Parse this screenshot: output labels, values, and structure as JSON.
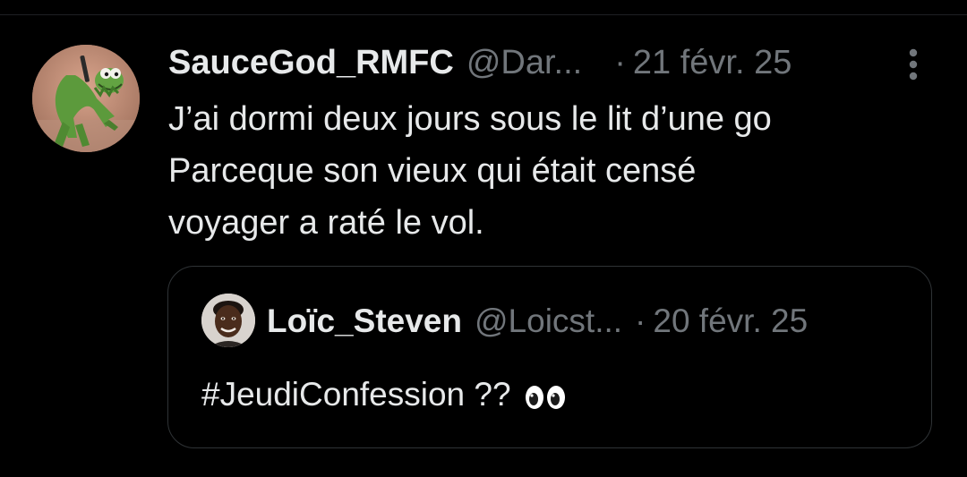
{
  "tweet": {
    "author": {
      "display_name": "SauceGod_RMFC",
      "handle": "@Dar...",
      "avatar_icon": "kermit-avatar-icon"
    },
    "separator": "·",
    "date": "21 févr. 25",
    "more_icon": "more-vertical-icon",
    "text_lines": [
      "J’ai dormi deux jours sous le lit d’une go",
      "Parceque son vieux qui était censé",
      "voyager a raté le vol."
    ]
  },
  "quoted_tweet": {
    "author": {
      "display_name": "Loïc_Steven",
      "handle": "@Loicst...",
      "avatar_icon": "user-avatar-icon"
    },
    "separator": "·",
    "date": "20 févr. 25",
    "text": "#JeudiConfession ??",
    "emoji_icon": "eyes-emoji-icon"
  },
  "colors": {
    "background": "#000000",
    "primary_text": "#e7e9ea",
    "secondary_text": "#71767b",
    "border": "#2f3336"
  }
}
